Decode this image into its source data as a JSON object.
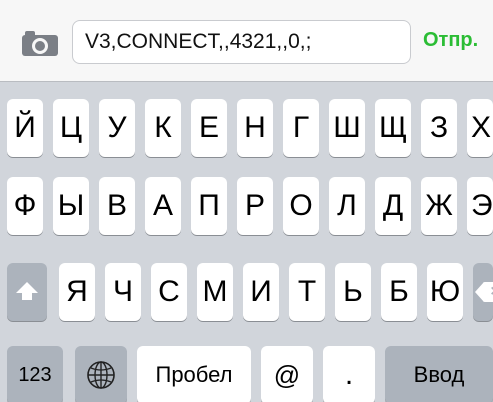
{
  "composer": {
    "camera_icon": "camera-icon",
    "message_value": "V3,CONNECT,,4321,,0,;",
    "send_label": "Отпр.",
    "send_color": "#2bbd35"
  },
  "keyboard": {
    "row1": [
      "Й",
      "Ц",
      "У",
      "К",
      "Е",
      "Н",
      "Г",
      "Ш",
      "Щ",
      "З",
      "Х"
    ],
    "row2": [
      "Ф",
      "Ы",
      "В",
      "А",
      "П",
      "Р",
      "О",
      "Л",
      "Д",
      "Ж",
      "Э"
    ],
    "row3": [
      "Я",
      "Ч",
      "С",
      "М",
      "И",
      "Т",
      "Ь",
      "Б",
      "Ю"
    ],
    "shift_icon": "shift-icon",
    "backspace_icon": "backspace-icon",
    "numbers_label": "123",
    "globe_icon": "globe-icon",
    "space_label": "Пробел",
    "at_label": "@",
    "dot_label": ".",
    "return_label": "Ввод",
    "key_color": "#ffffff",
    "function_key_color": "#acb3bc",
    "background_color": "#d1d5db"
  }
}
